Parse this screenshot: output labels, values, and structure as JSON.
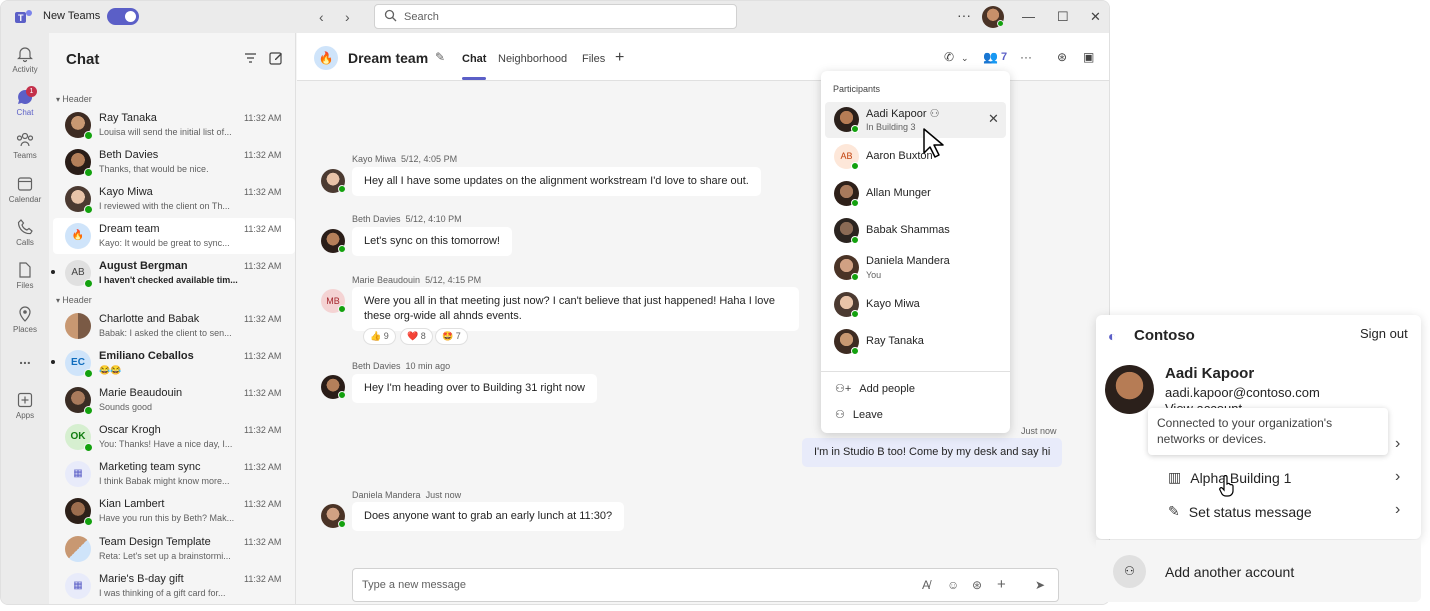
{
  "titlebar": {
    "new_teams_label": "New Teams",
    "search_placeholder": "Search"
  },
  "rail": [
    {
      "label": "Activity",
      "icon": "bell-icon"
    },
    {
      "label": "Chat",
      "icon": "chat-icon",
      "badge": "1"
    },
    {
      "label": "Teams",
      "icon": "teams-icon"
    },
    {
      "label": "Calendar",
      "icon": "calendar-icon"
    },
    {
      "label": "Calls",
      "icon": "phone-icon"
    },
    {
      "label": "Files",
      "icon": "file-icon"
    },
    {
      "label": "Places",
      "icon": "location-icon"
    },
    {
      "label": "...",
      "icon": "more-icon"
    },
    {
      "label": "Apps",
      "icon": "add-app-icon"
    }
  ],
  "chatlist": {
    "title": "Chat",
    "section1": "Header",
    "section2": "Header",
    "items": [
      {
        "name": "Ray Tanaka",
        "preview": "Louisa will send the initial list of...",
        "time": "11:32 AM"
      },
      {
        "name": "Beth Davies",
        "preview": "Thanks, that would be nice.",
        "time": "11:32 AM"
      },
      {
        "name": "Kayo Miwa",
        "preview": "I reviewed with the client on Th...",
        "time": "11:32 AM"
      },
      {
        "name": "Dream team",
        "preview": "Kayo: It would be great to sync...",
        "time": "11:32 AM"
      },
      {
        "name": "August Bergman",
        "preview": "I haven't checked available tim...",
        "time": "11:32 AM",
        "initials": "AB"
      },
      {
        "name": "Charlotte and Babak",
        "preview": "Babak: I asked the client to sen...",
        "time": "11:32 AM"
      },
      {
        "name": "Emiliano Ceballos",
        "preview": "😂😂",
        "time": "11:32 AM",
        "initials": "EC"
      },
      {
        "name": "Marie Beaudouin",
        "preview": "Sounds good",
        "time": "11:32 AM"
      },
      {
        "name": "Oscar Krogh",
        "preview": "You: Thanks! Have a nice day, I...",
        "time": "11:32 AM",
        "initials": "OK"
      },
      {
        "name": "Marketing team sync",
        "preview": "I think Babak might know more...",
        "time": "11:32 AM"
      },
      {
        "name": "Kian Lambert",
        "preview": "Have you run this by Beth? Mak...",
        "time": "11:32 AM"
      },
      {
        "name": "Team Design Template",
        "preview": "Reta: Let's set up a brainstormi...",
        "time": "11:32 AM"
      },
      {
        "name": "Marie's B-day gift",
        "preview": "I was thinking of a gift card for...",
        "time": "11:32 AM"
      }
    ]
  },
  "header": {
    "title": "Dream team",
    "tabs": [
      "Chat",
      "Neighborhood",
      "Files"
    ],
    "people_count": "7"
  },
  "messages": [
    {
      "sender": "Kayo Miwa",
      "time": "5/12, 4:05 PM",
      "text": "Hey all I have some updates on the alignment workstream I'd love to share out."
    },
    {
      "sender": "Beth Davies",
      "time": "5/12, 4:10 PM",
      "text": "Let's sync on this tomorrow!"
    },
    {
      "sender": "Marie Beaudouin",
      "time": "5/12, 4:15 PM",
      "text_line1": "Were you all in that meeting just now? I can't believe that just happened! Haha I love",
      "text_line2": "these org-wide all ahnds events.",
      "initials": "MB",
      "reactions": [
        {
          "emoji": "👍",
          "count": "9"
        },
        {
          "emoji": "❤️",
          "count": "8"
        },
        {
          "emoji": "🤩",
          "count": "7"
        }
      ]
    },
    {
      "sender": "Beth Davies",
      "time": "10 min ago",
      "text": "Hey I'm heading over to Building 31 right now"
    },
    {
      "time": "Just now",
      "text": "I'm in Studio B too! Come by my desk and say hi"
    },
    {
      "sender": "Daniela Mandera",
      "time": "Just now",
      "text": "Does anyone want to grab an early lunch at 11:30?"
    }
  ],
  "composer": {
    "placeholder": "Type a new message"
  },
  "participants": {
    "title": "Participants",
    "people": [
      {
        "name": "Aadi Kapoor",
        "sub": "In Building 3"
      },
      {
        "name": "Aaron Buxton",
        "initials": "AB"
      },
      {
        "name": "Allan Munger"
      },
      {
        "name": "Babak Shammas"
      },
      {
        "name": "Daniela Mandera",
        "sub": "You"
      },
      {
        "name": "Kayo Miwa"
      },
      {
        "name": "Ray Tanaka"
      }
    ],
    "add_people": "Add people",
    "leave": "Leave"
  },
  "account": {
    "org": "Contoso",
    "sign_out": "Sign out",
    "name": "Aadi Kapoor",
    "email": "aadi.kapoor@contoso.com",
    "view_account": "View account",
    "tooltip": "Connected to your organization's networks or devices.",
    "location": "Alpha Building 1",
    "status": "Set status message",
    "add_account": "Add another account"
  },
  "colors": {
    "brand": "#5b5fc7",
    "presence": "#13a10e",
    "badge": "#c4314b"
  }
}
